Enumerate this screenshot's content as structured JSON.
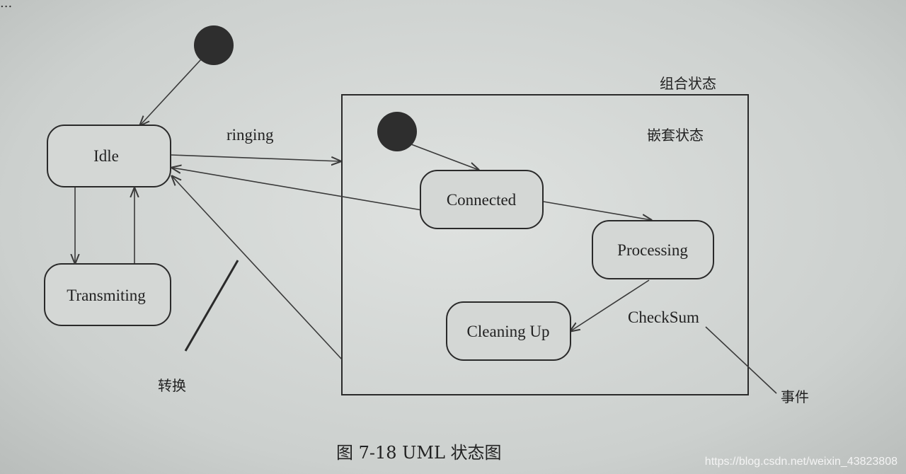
{
  "top_fragment": "...",
  "states": {
    "idle": "Idle",
    "transmiting": "Transmiting",
    "connected": "Connected",
    "processing": "Processing",
    "cleaning_up": "Cleaning Up"
  },
  "edge_labels": {
    "ringing": "ringing",
    "checksum": "CheckSum"
  },
  "annotations": {
    "composite_state": "组合状态",
    "nested_state": "嵌套状态",
    "transition": "转换",
    "event": "事件"
  },
  "caption": "图 7-18   UML 状态图",
  "watermark": "https://blog.csdn.net/weixin_43823808"
}
